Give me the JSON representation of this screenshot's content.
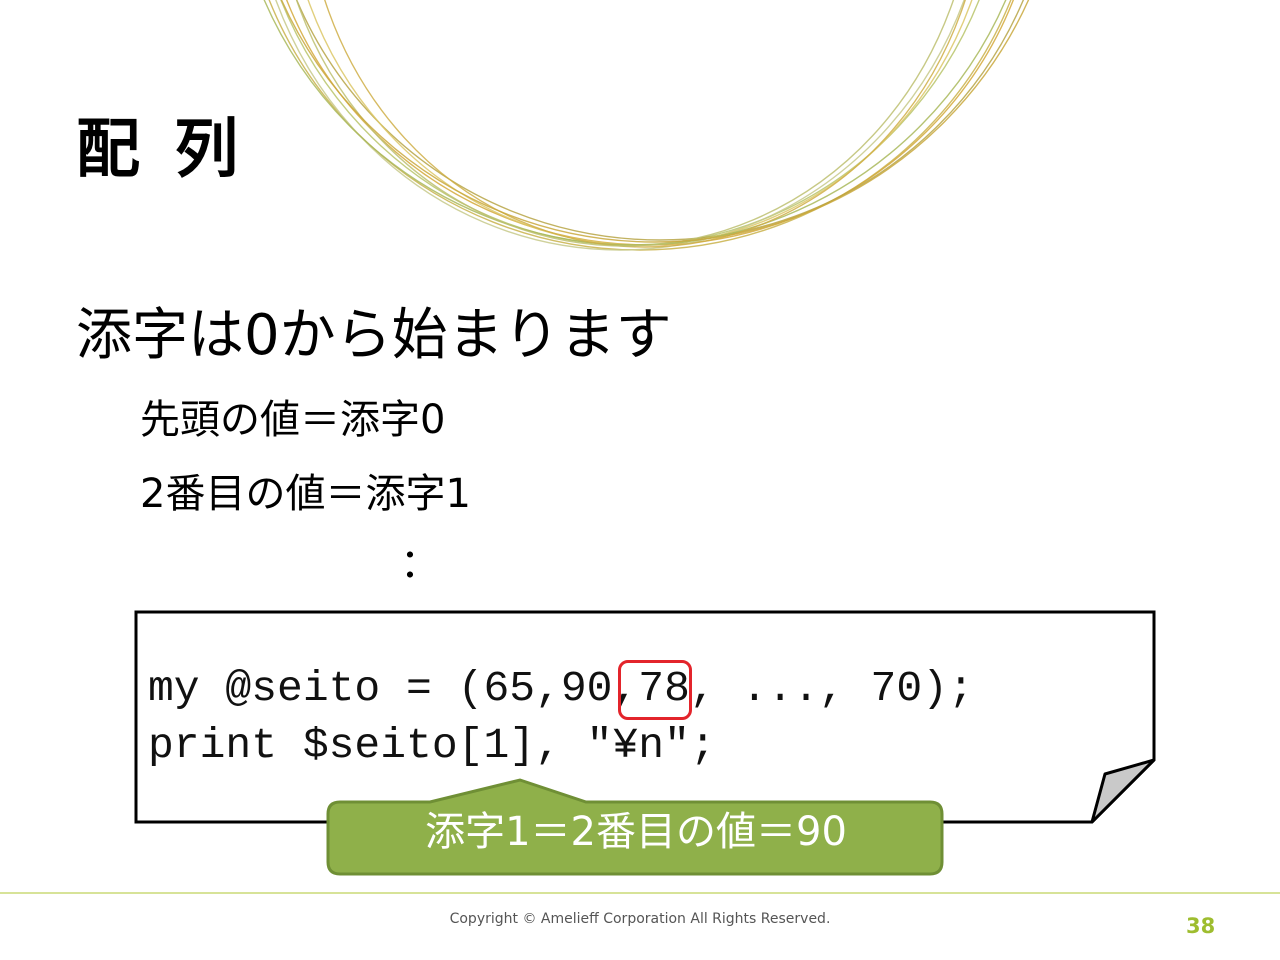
{
  "slide": {
    "title": "配 列",
    "lead": "添字は0から始まります",
    "sub_items": [
      "先頭の値＝添字0",
      "2番目の値＝添字1"
    ],
    "continuation": "："
  },
  "code": {
    "line1_before": "my @seito = (65,",
    "line1_highlight": "90",
    "line1_after": ",78, ..., 70);",
    "line2": "print $seito[1], \"¥n\";"
  },
  "callout": {
    "text": "添字1＝2番目の値＝90",
    "color": "#8fb04a",
    "border_color": "#6f8f35"
  },
  "highlight_color": "#e3242b",
  "accent_color": "#9ebd2f",
  "footer": {
    "copyright": "Copyright © Amelieff Corporation All Rights Reserved.",
    "page_number": "38"
  }
}
